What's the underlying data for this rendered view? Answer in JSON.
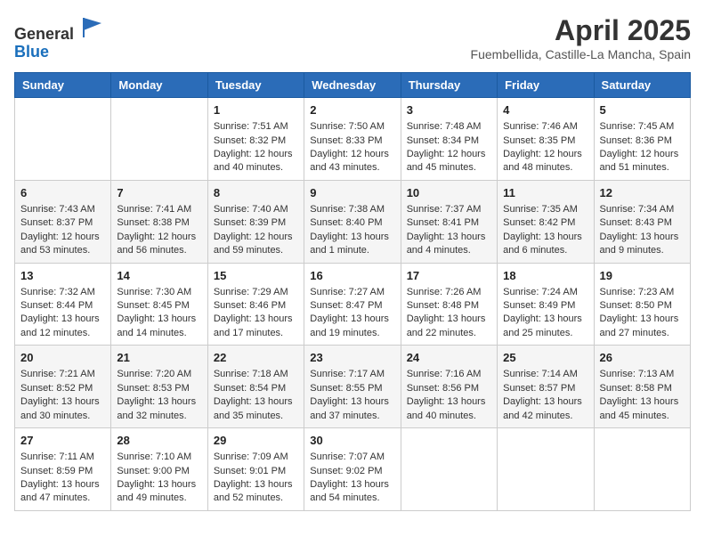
{
  "header": {
    "logo_general": "General",
    "logo_blue": "Blue",
    "month_year": "April 2025",
    "location": "Fuembellida, Castille-La Mancha, Spain"
  },
  "columns": [
    "Sunday",
    "Monday",
    "Tuesday",
    "Wednesday",
    "Thursday",
    "Friday",
    "Saturday"
  ],
  "weeks": [
    [
      {
        "day": "",
        "sunrise": "",
        "sunset": "",
        "daylight": ""
      },
      {
        "day": "",
        "sunrise": "",
        "sunset": "",
        "daylight": ""
      },
      {
        "day": "1",
        "sunrise": "Sunrise: 7:51 AM",
        "sunset": "Sunset: 8:32 PM",
        "daylight": "Daylight: 12 hours and 40 minutes."
      },
      {
        "day": "2",
        "sunrise": "Sunrise: 7:50 AM",
        "sunset": "Sunset: 8:33 PM",
        "daylight": "Daylight: 12 hours and 43 minutes."
      },
      {
        "day": "3",
        "sunrise": "Sunrise: 7:48 AM",
        "sunset": "Sunset: 8:34 PM",
        "daylight": "Daylight: 12 hours and 45 minutes."
      },
      {
        "day": "4",
        "sunrise": "Sunrise: 7:46 AM",
        "sunset": "Sunset: 8:35 PM",
        "daylight": "Daylight: 12 hours and 48 minutes."
      },
      {
        "day": "5",
        "sunrise": "Sunrise: 7:45 AM",
        "sunset": "Sunset: 8:36 PM",
        "daylight": "Daylight: 12 hours and 51 minutes."
      }
    ],
    [
      {
        "day": "6",
        "sunrise": "Sunrise: 7:43 AM",
        "sunset": "Sunset: 8:37 PM",
        "daylight": "Daylight: 12 hours and 53 minutes."
      },
      {
        "day": "7",
        "sunrise": "Sunrise: 7:41 AM",
        "sunset": "Sunset: 8:38 PM",
        "daylight": "Daylight: 12 hours and 56 minutes."
      },
      {
        "day": "8",
        "sunrise": "Sunrise: 7:40 AM",
        "sunset": "Sunset: 8:39 PM",
        "daylight": "Daylight: 12 hours and 59 minutes."
      },
      {
        "day": "9",
        "sunrise": "Sunrise: 7:38 AM",
        "sunset": "Sunset: 8:40 PM",
        "daylight": "Daylight: 13 hours and 1 minute."
      },
      {
        "day": "10",
        "sunrise": "Sunrise: 7:37 AM",
        "sunset": "Sunset: 8:41 PM",
        "daylight": "Daylight: 13 hours and 4 minutes."
      },
      {
        "day": "11",
        "sunrise": "Sunrise: 7:35 AM",
        "sunset": "Sunset: 8:42 PM",
        "daylight": "Daylight: 13 hours and 6 minutes."
      },
      {
        "day": "12",
        "sunrise": "Sunrise: 7:34 AM",
        "sunset": "Sunset: 8:43 PM",
        "daylight": "Daylight: 13 hours and 9 minutes."
      }
    ],
    [
      {
        "day": "13",
        "sunrise": "Sunrise: 7:32 AM",
        "sunset": "Sunset: 8:44 PM",
        "daylight": "Daylight: 13 hours and 12 minutes."
      },
      {
        "day": "14",
        "sunrise": "Sunrise: 7:30 AM",
        "sunset": "Sunset: 8:45 PM",
        "daylight": "Daylight: 13 hours and 14 minutes."
      },
      {
        "day": "15",
        "sunrise": "Sunrise: 7:29 AM",
        "sunset": "Sunset: 8:46 PM",
        "daylight": "Daylight: 13 hours and 17 minutes."
      },
      {
        "day": "16",
        "sunrise": "Sunrise: 7:27 AM",
        "sunset": "Sunset: 8:47 PM",
        "daylight": "Daylight: 13 hours and 19 minutes."
      },
      {
        "day": "17",
        "sunrise": "Sunrise: 7:26 AM",
        "sunset": "Sunset: 8:48 PM",
        "daylight": "Daylight: 13 hours and 22 minutes."
      },
      {
        "day": "18",
        "sunrise": "Sunrise: 7:24 AM",
        "sunset": "Sunset: 8:49 PM",
        "daylight": "Daylight: 13 hours and 25 minutes."
      },
      {
        "day": "19",
        "sunrise": "Sunrise: 7:23 AM",
        "sunset": "Sunset: 8:50 PM",
        "daylight": "Daylight: 13 hours and 27 minutes."
      }
    ],
    [
      {
        "day": "20",
        "sunrise": "Sunrise: 7:21 AM",
        "sunset": "Sunset: 8:52 PM",
        "daylight": "Daylight: 13 hours and 30 minutes."
      },
      {
        "day": "21",
        "sunrise": "Sunrise: 7:20 AM",
        "sunset": "Sunset: 8:53 PM",
        "daylight": "Daylight: 13 hours and 32 minutes."
      },
      {
        "day": "22",
        "sunrise": "Sunrise: 7:18 AM",
        "sunset": "Sunset: 8:54 PM",
        "daylight": "Daylight: 13 hours and 35 minutes."
      },
      {
        "day": "23",
        "sunrise": "Sunrise: 7:17 AM",
        "sunset": "Sunset: 8:55 PM",
        "daylight": "Daylight: 13 hours and 37 minutes."
      },
      {
        "day": "24",
        "sunrise": "Sunrise: 7:16 AM",
        "sunset": "Sunset: 8:56 PM",
        "daylight": "Daylight: 13 hours and 40 minutes."
      },
      {
        "day": "25",
        "sunrise": "Sunrise: 7:14 AM",
        "sunset": "Sunset: 8:57 PM",
        "daylight": "Daylight: 13 hours and 42 minutes."
      },
      {
        "day": "26",
        "sunrise": "Sunrise: 7:13 AM",
        "sunset": "Sunset: 8:58 PM",
        "daylight": "Daylight: 13 hours and 45 minutes."
      }
    ],
    [
      {
        "day": "27",
        "sunrise": "Sunrise: 7:11 AM",
        "sunset": "Sunset: 8:59 PM",
        "daylight": "Daylight: 13 hours and 47 minutes."
      },
      {
        "day": "28",
        "sunrise": "Sunrise: 7:10 AM",
        "sunset": "Sunset: 9:00 PM",
        "daylight": "Daylight: 13 hours and 49 minutes."
      },
      {
        "day": "29",
        "sunrise": "Sunrise: 7:09 AM",
        "sunset": "Sunset: 9:01 PM",
        "daylight": "Daylight: 13 hours and 52 minutes."
      },
      {
        "day": "30",
        "sunrise": "Sunrise: 7:07 AM",
        "sunset": "Sunset: 9:02 PM",
        "daylight": "Daylight: 13 hours and 54 minutes."
      },
      {
        "day": "",
        "sunrise": "",
        "sunset": "",
        "daylight": ""
      },
      {
        "day": "",
        "sunrise": "",
        "sunset": "",
        "daylight": ""
      },
      {
        "day": "",
        "sunrise": "",
        "sunset": "",
        "daylight": ""
      }
    ]
  ]
}
